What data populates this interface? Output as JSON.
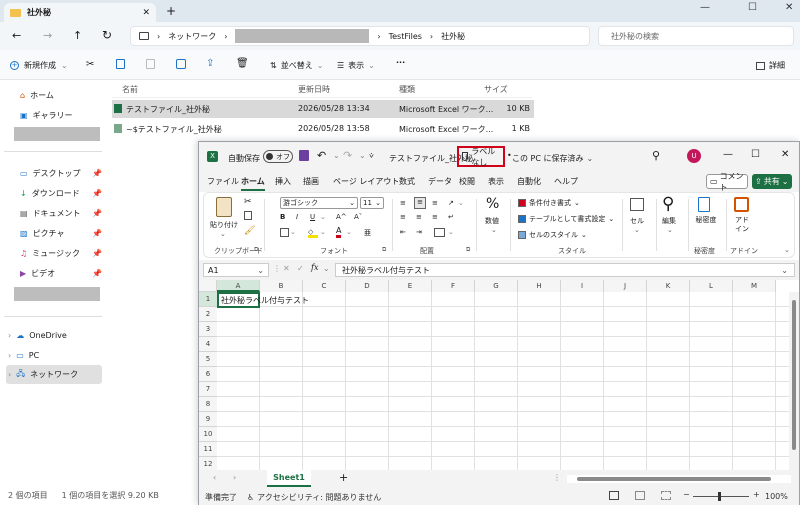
{
  "explorer": {
    "tab_title": "社外秘",
    "address": {
      "network": "ネットワーク",
      "folder1": "TestFiles",
      "folder2": "社外秘"
    },
    "search_placeholder": "社外秘の検索",
    "cmd": {
      "new": "新規作成",
      "sort": "並べ替え",
      "view": "表示",
      "more": "···",
      "details": "詳細"
    },
    "sidebar": [
      "ホーム",
      "ギャラリー",
      "デスクトップ",
      "ダウンロード",
      "ドキュメント",
      "ピクチャ",
      "ミュージック",
      "ビデオ",
      "OneDrive",
      "PC",
      "ネットワーク"
    ],
    "columns": [
      "名前",
      "更新日時",
      "種類",
      "サイズ"
    ],
    "files": [
      {
        "name": "テストファイル_社外秘",
        "date": "2026/05/28 13:34",
        "type": "Microsoft Excel ワーク...",
        "size": "10 KB"
      },
      {
        "name": "~$テストファイル_社外秘",
        "date": "2026/05/28 13:58",
        "type": "Microsoft Excel ワーク...",
        "size": "1 KB"
      }
    ],
    "status": {
      "count": "2 個の項目",
      "selected": "1 個の項目を選択  9.20 KB"
    }
  },
  "excel": {
    "autosave": "自動保存",
    "toggle": "オフ",
    "filename": "テストファイル_社外秘",
    "label": "ラベルなし",
    "saved": "この PC に保存済み",
    "avatar": "U",
    "menu": [
      "ファイル",
      "ホーム",
      "挿入",
      "描画",
      "ページ レイアウト",
      "数式",
      "データ",
      "校閲",
      "表示",
      "自動化",
      "ヘルプ"
    ],
    "comment": "コメント",
    "share": "共有",
    "ribbon": {
      "paste": "貼り付け",
      "clipboard": "クリップボード",
      "font_name": "游ゴシック",
      "font_size": "11",
      "font": "フォント",
      "align": "配置",
      "number": "数値",
      "cond": "条件付き書式",
      "table": "テーブルとして書式設定",
      "cellstyle": "セルのスタイル",
      "style": "スタイル",
      "cell": "セル",
      "edit": "編集",
      "sens": "秘密度",
      "sens_grp": "秘密度",
      "addin": "アド イン",
      "addin_grp": "アドイン"
    },
    "namebox": "A1",
    "fx": "fx",
    "formula": "社外秘ラベル付与テスト",
    "cols": [
      "A",
      "B",
      "C",
      "D",
      "E",
      "F",
      "G",
      "H",
      "I",
      "J",
      "K",
      "L",
      "M"
    ],
    "rows": [
      "1",
      "2",
      "3",
      "4",
      "5",
      "6",
      "7",
      "8",
      "9",
      "10",
      "11",
      "12"
    ],
    "a1": "社外秘ラベル付与テスト",
    "sheet": "Sheet1",
    "status": {
      "ready": "準備完了",
      "access": "アクセシビリティ: 問題ありません",
      "zoom": "100%"
    }
  }
}
